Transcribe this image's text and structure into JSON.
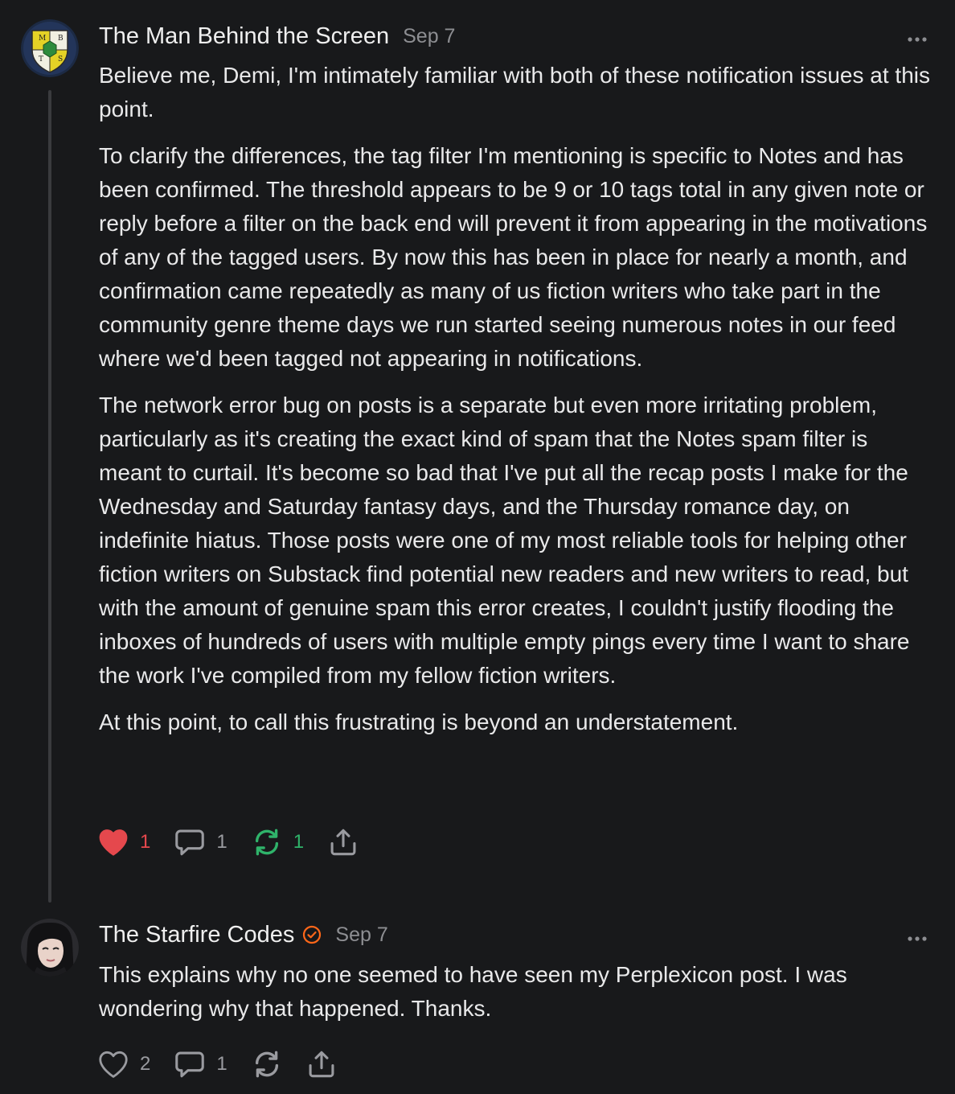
{
  "comments": [
    {
      "author": "The Man Behind the Screen",
      "date": "Sep 7",
      "avatar_letters": [
        "M",
        "B",
        "T",
        "S"
      ],
      "paragraphs": [
        "Believe me, Demi, I'm intimately familiar with both of these notification issues at this point.",
        "To clarify the differences, the tag filter I'm mentioning is specific to Notes and has been confirmed. The threshold appears to be 9 or 10 tags total in any given note or reply before a filter on the back end will prevent it from appearing in the motivations of any of the tagged users. By now this has been in place for nearly a month, and confirmation came repeatedly as many of us fiction writers who take part in the community genre theme days we run started seeing numerous notes in our feed where we'd been tagged not appearing in notifications.",
        "The network error bug on posts is a separate but even more irritating problem, particularly as it's creating the exact kind of spam that the Notes spam filter is meant to curtail. It's become so bad that I've put all the recap posts I make for the Wednesday and Saturday fantasy days, and the Thursday romance day, on indefinite hiatus. Those posts were one of my most reliable tools for helping other fiction writers on Substack find potential new readers and new writers to read, but with the amount of genuine spam this error creates, I couldn't justify flooding the inboxes of hundreds of users with multiple empty pings every time I want to share the work I've compiled from my fellow fiction writers.",
        "At this point, to call this frustrating is beyond an understatement."
      ],
      "actions": {
        "likes": "1",
        "replies": "1",
        "restacks": "1"
      },
      "liked": true,
      "restacked": true
    },
    {
      "author": "The Starfire Codes",
      "date": "Sep 7",
      "verified": true,
      "paragraphs": [
        "This explains why no one seemed to have seen my Perplexicon post. I was wondering why that happened. Thanks."
      ],
      "actions": {
        "likes": "2",
        "replies": "1",
        "restacks": ""
      },
      "liked": false,
      "restacked": false
    }
  ],
  "icons": {
    "like": "heart-icon",
    "reply": "comment-bubble-icon",
    "restack": "restack-icon",
    "share": "share-icon",
    "more": "more-dots-icon",
    "verified": "verified-badge-icon"
  },
  "colors": {
    "background": "#18191b",
    "text": "#e9e9ea",
    "muted": "#8d8e92",
    "like_active": "#e5484d",
    "restack_active": "#2fb36a",
    "verified": "#ff6719"
  }
}
